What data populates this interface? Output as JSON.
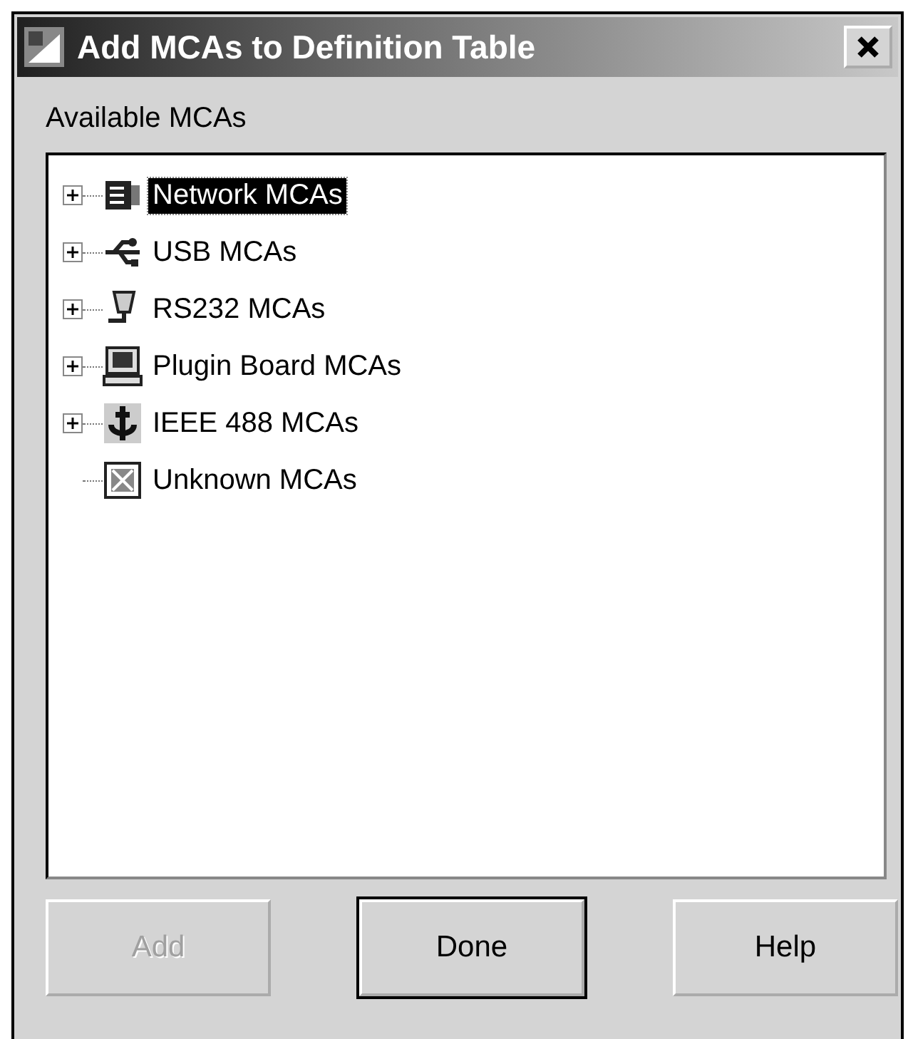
{
  "window": {
    "title": "Add MCAs to Definition Table"
  },
  "tree": {
    "label": "Available MCAs",
    "items": [
      {
        "label": "Network MCAs",
        "kind": "network",
        "expandable": true,
        "selected": true
      },
      {
        "label": "USB MCAs",
        "kind": "usb",
        "expandable": true,
        "selected": false
      },
      {
        "label": "RS232 MCAs",
        "kind": "serial",
        "expandable": true,
        "selected": false
      },
      {
        "label": "Plugin Board MCAs",
        "kind": "computer",
        "expandable": true,
        "selected": false
      },
      {
        "label": "IEEE 488 MCAs",
        "kind": "anchor",
        "expandable": true,
        "selected": false
      },
      {
        "label": "Unknown MCAs",
        "kind": "unknown",
        "expandable": false,
        "selected": false
      }
    ]
  },
  "buttons": [
    {
      "label": "Add",
      "disabled": true,
      "default": false
    },
    {
      "label": "Done",
      "disabled": false,
      "default": true
    },
    {
      "label": "Help",
      "disabled": false,
      "default": false
    }
  ]
}
